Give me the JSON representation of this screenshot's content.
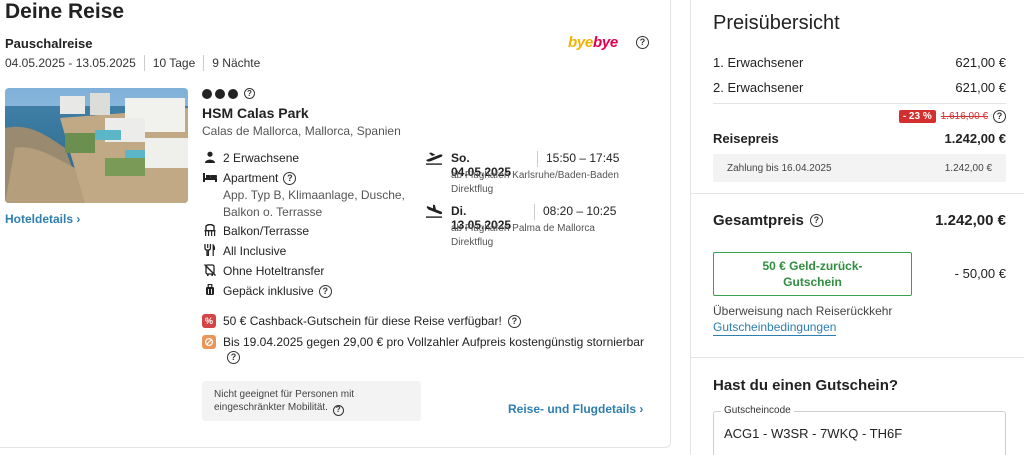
{
  "trip": {
    "title": "Deine Reise",
    "package_type": "Pauschalreise",
    "date_range": "04.05.2025 - 13.05.2025",
    "days": "10 Tage",
    "nights": "9 Nächte",
    "brand": {
      "part1": "bye",
      "part2": "bye"
    },
    "help_glyph": "?"
  },
  "hotel": {
    "stars": 3,
    "name": "HSM Calas Park",
    "location": "Calas de Mallorca, Mallorca, Spanien",
    "details_link": "Hoteldetails",
    "details_chevron": "›",
    "features": {
      "travellers": "2 Erwachsene",
      "room_type": "Apartment",
      "room_detail": "App. Typ B, Klimaanlage, Dusche, Balkon o. Terrasse",
      "view": "Balkon/Terrasse",
      "board": "All Inclusive",
      "transfer": "Ohne Hoteltransfer",
      "luggage": "Gepäck inklusive"
    }
  },
  "flights": {
    "outbound": {
      "day": "So. 04.05.2025",
      "time": "15:50 – 17:45",
      "from": "ab Flughafen Karlsruhe/Baden-Baden",
      "type": "Direktflug"
    },
    "return": {
      "day": "Di. 13.05.2025",
      "time": "08:20 – 10:25",
      "from": "ab Flughafen Palma de Mallorca",
      "type": "Direktflug"
    }
  },
  "promos": {
    "cashback_badge": "%",
    "cashback": "50 € Cashback-Gutschein für diese Reise verfügbar!",
    "cancel": "Bis 19.04.2025 gegen 29,00 € pro Vollzahler Aufpreis kostengünstig stornierbar"
  },
  "mobility_note": "Nicht geeignet für Personen mit eingeschränkter Mobilität.",
  "trip_details_link": "Reise- und Flugdetails",
  "price": {
    "title": "Preisübersicht",
    "rows": [
      {
        "label": "1. Erwachsener",
        "value": "621,00 €"
      },
      {
        "label": "2. Erwachsener",
        "value": "621,00 €"
      }
    ],
    "discount_badge": "- 23 %",
    "old_price": "1.616,00 €",
    "travel_price_label": "Reisepreis",
    "travel_price": "1.242,00 €",
    "payment_label": "Zahlung bis 16.04.2025",
    "payment_value": "1.242,00 €",
    "total_label": "Gesamtpreis",
    "total_value": "1.242,00 €",
    "voucher_label": "50 € Geld-zurück-Gutschein",
    "voucher_value": "- 50,00 €",
    "transfer_note": "Überweisung nach Reiserückkehr",
    "conditions_link": "Gutscheinbedingungen"
  },
  "coupon": {
    "title": "Hast du einen Gutschein?",
    "field_label": "Gutscheincode",
    "value": "ACG1 - W3SR - 7WKQ - TH6F"
  },
  "colors": {
    "link": "#2e7fb0",
    "green": "#39a04b",
    "red": "#d32f2f",
    "cashback_badge": "#d64545",
    "cancel_badge": "#e8965a"
  }
}
